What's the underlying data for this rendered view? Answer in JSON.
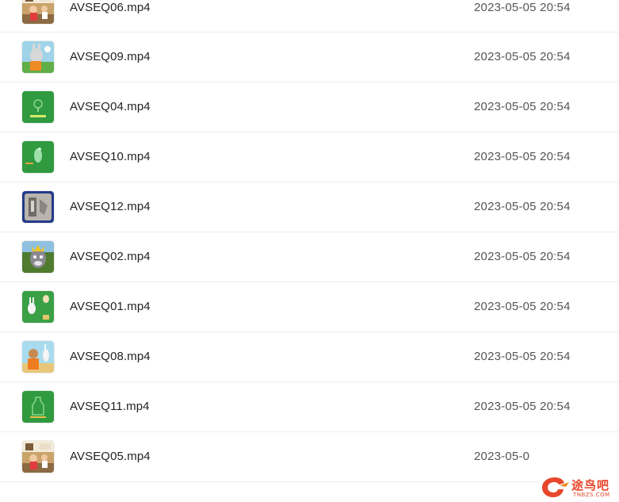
{
  "files": [
    {
      "name": "AVSEQ06.mp4",
      "date": "2023-05-05 20:54",
      "thumb": "classroom-scene-thumbnail"
    },
    {
      "name": "AVSEQ09.mp4",
      "date": "2023-05-05 20:54",
      "thumb": "cartoon-rabbit-thumbnail"
    },
    {
      "name": "AVSEQ04.mp4",
      "date": "2023-05-05 20:54",
      "thumb": "green-title-card-thumbnail"
    },
    {
      "name": "AVSEQ10.mp4",
      "date": "2023-05-05 20:54",
      "thumb": "green-cartoon-thumbnail"
    },
    {
      "name": "AVSEQ12.mp4",
      "date": "2023-05-05 20:54",
      "thumb": "blue-frame-tablet-thumbnail"
    },
    {
      "name": "AVSEQ02.mp4",
      "date": "2023-05-05 20:54",
      "thumb": "cartoon-wolf-thumbnail"
    },
    {
      "name": "AVSEQ01.mp4",
      "date": "2023-05-05 20:54",
      "thumb": "green-rabbits-thumbnail"
    },
    {
      "name": "AVSEQ08.mp4",
      "date": "2023-05-05 20:54",
      "thumb": "cartoon-monkey-thumbnail"
    },
    {
      "name": "AVSEQ11.mp4",
      "date": "2023-05-05 20:54",
      "thumb": "green-bottle-thumbnail"
    },
    {
      "name": "AVSEQ05.mp4",
      "date": "2023-05-0",
      "thumb": "classroom-scene-thumbnail"
    }
  ],
  "watermark": {
    "text": "途鸟吧",
    "subtext": "TNBZS.COM",
    "color": "#e8472c"
  }
}
